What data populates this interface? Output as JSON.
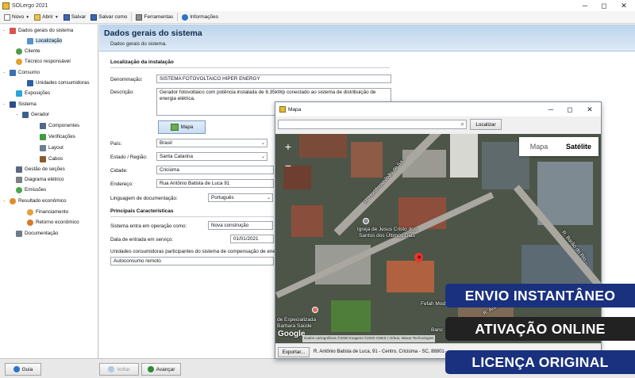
{
  "app": {
    "title": "SOLergo 2021"
  },
  "window_controls": {
    "minimize": "─",
    "maximize": "◻",
    "close": "✕"
  },
  "toolbar": {
    "new_label": "Novo",
    "open_label": "Abrir",
    "save_label": "Salvar",
    "save_as_label": "Salvar como",
    "tools_label": "Ferramentas",
    "info_label": "Informações"
  },
  "tree": [
    {
      "label": "Dados gerais do sistema",
      "expander": "−"
    },
    {
      "label": "Localização",
      "selected": true
    },
    {
      "label": "Cliente"
    },
    {
      "label": "Técnico responsável"
    },
    {
      "label": "Consumo",
      "expander": "−"
    },
    {
      "label": "Unidades consumidoras"
    },
    {
      "label": "Exposições"
    },
    {
      "label": "Sistema",
      "expander": "−"
    },
    {
      "label": "Gerador",
      "expander": "−"
    },
    {
      "label": "Componentes"
    },
    {
      "label": "Verificações"
    },
    {
      "label": "Layout"
    },
    {
      "label": "Cabos"
    },
    {
      "label": "Gestão de seções"
    },
    {
      "label": "Diagrama elétrico"
    },
    {
      "label": "Emissões"
    },
    {
      "label": "Resultado econômico",
      "expander": "−"
    },
    {
      "label": "Financiamento"
    },
    {
      "label": "Retorno econômico"
    },
    {
      "label": "Documentação"
    }
  ],
  "header": {
    "title": "Dados gerais do sistema",
    "subtitle": "Dados gerais do sistema."
  },
  "form": {
    "section_location": "Localização da instalação",
    "denomination_label": "Denominação:",
    "denomination_value": "SISTEMA FOTOVOLTAICO HIPER ENERGY",
    "description_label": "Descrição:",
    "description_value": "Gerador fotovoltaico com potência instalada de 8.35kWp conectado ao sistema de distribuição de energia elétrica.",
    "map_button": "Mapa",
    "country_label": "País:",
    "country_value": "Brasil",
    "state_label": "Estado / Região:",
    "state_value": "Santa Catarina",
    "city_label": "Cidade:",
    "city_value": "Criciúma",
    "address_label": "Endereço:",
    "address_value": "Rua Antônio Batista de Luca 91",
    "language_label": "Linguagem de documentação:",
    "language_value": "Português",
    "section_main": "Principais Características",
    "operation_label": "Sistema entra em operação como:",
    "operation_value": "Nova construção",
    "service_date_label": "Data de entrada em serviço:",
    "service_date_value": "01/01/2021",
    "compensation_label": "Unidades consumidoras participantes do sistema de compensação de energia",
    "compensation_value": "Autoconsumo remoto"
  },
  "bottom": {
    "help_label": "Guia",
    "back_label": "Voltar",
    "next_label": "Avançar"
  },
  "map_window": {
    "title": "Mapa",
    "search_placeholder": "",
    "locate_button": "Localizar",
    "map_type_map": "Mapa",
    "map_type_satellite": "Satélite",
    "zoom_in": "+",
    "zoom_out": "−",
    "road_label_1": "R. Hortêncio João de Sa...",
    "road_label_2": "R. Barão do Rio...",
    "road_label_3": "R. Antônio...",
    "poi_church": "Igreja de Jesus Cristo dos Santos dos Últimos Dias",
    "poi_fefah": "Fefah Moda",
    "poi_health": "de Especializada Barbara Saúde",
    "poi_banco": "Banc",
    "google_logo": "Google",
    "attribution": "Dados cartográficos ©2020 Imagens ©2020 CNES / Airbus, Maxar Technologies",
    "export_button": "Exportar...",
    "address_readout": "R. Antônio Batista de Luca, 91 - Centro, Criciúma - SC, 88801-..."
  },
  "banners": {
    "b1": "ENVIO INSTANTÂNEO",
    "b2": "ATIVAÇÃO ONLINE",
    "b3": "LICENÇA ORIGINAL"
  },
  "colors": {
    "banner_blue": "#19317e",
    "banner_black": "#222222",
    "header_blue": "#bcd4ec",
    "pin_red": "#e8352a"
  }
}
